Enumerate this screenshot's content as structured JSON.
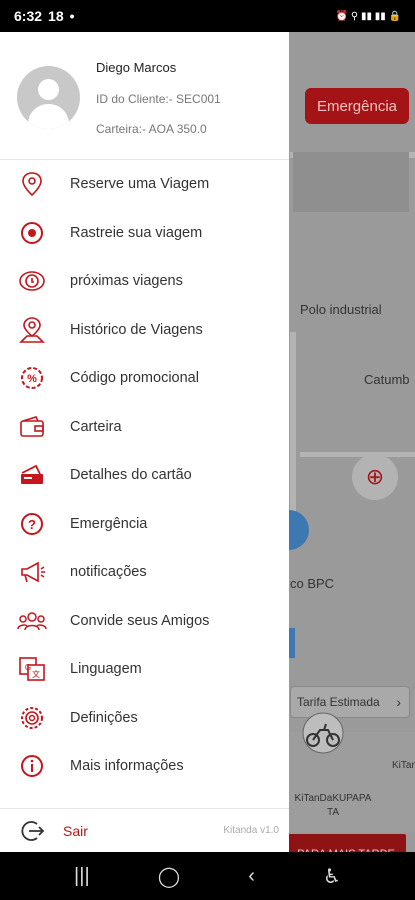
{
  "status_bar": {
    "time": "6:32",
    "extra": "18",
    "right_icons": "⏰ ⚲ ▮▮ ▮▮ 🔒"
  },
  "map": {
    "emergency_label": "Emergência",
    "place_label_1": "Polo industrial",
    "place_label_2": "Catumb",
    "place_label_3": "co BPC",
    "fare_label": "Tarifa Estimada",
    "vehicle_name": "KiTanDaKUPAPA TA",
    "vehicle_name_2": "KiTanI",
    "later_label": "PARA MAIS TARDE"
  },
  "profile": {
    "name": "Diego Marcos",
    "client_id": "ID do Cliente:- SEC001",
    "wallet": "Carteira:- AOA 350.0"
  },
  "menu": [
    {
      "label": "Reserve uma Viagem",
      "icon": "pin-icon"
    },
    {
      "label": "Rastreie sua viagem",
      "icon": "target-icon"
    },
    {
      "label": "próximas viagens",
      "icon": "upcoming-icon"
    },
    {
      "label": "Histórico de Viagens",
      "icon": "history-icon"
    },
    {
      "label": "Código promocional",
      "icon": "promo-icon"
    },
    {
      "label": "Carteira",
      "icon": "wallet-icon"
    },
    {
      "label": "Detalhes do cartão",
      "icon": "card-icon"
    },
    {
      "label": "Emergência",
      "icon": "help-icon"
    },
    {
      "label": "notificações",
      "icon": "megaphone-icon"
    },
    {
      "label": "Convide seus Amigos",
      "icon": "friends-icon"
    },
    {
      "label": "Linguagem",
      "icon": "language-icon"
    },
    {
      "label": "Definições",
      "icon": "settings-icon"
    },
    {
      "label": "Mais informações",
      "icon": "info-icon"
    }
  ],
  "footer": {
    "logout_label": "Sair",
    "version": "Kitanda v1.0"
  },
  "colors": {
    "accent": "#c4161c",
    "text": "#333333"
  }
}
